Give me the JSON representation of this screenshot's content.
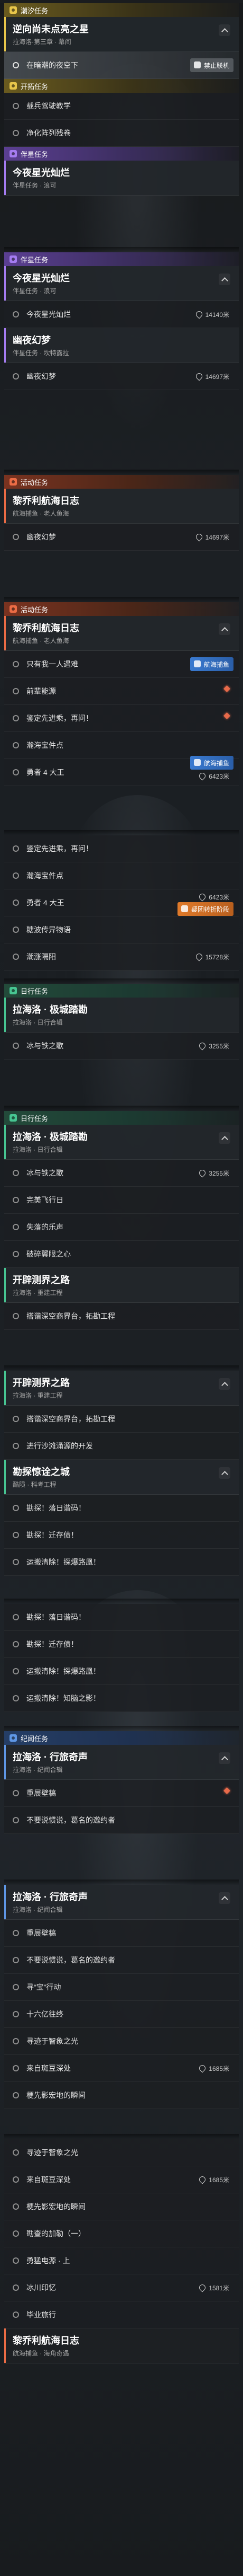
{
  "colors": {
    "trial": "#e8c64a",
    "quest": "#a57cf2",
    "event": "#ec6c45",
    "daily": "#47c592",
    "story": "#5f97e6"
  },
  "cat": {
    "trial": "潮汐任务",
    "trailblaze": "开拓任务",
    "companion": "伴星任务",
    "event": "活动任务",
    "daily": "日常任务",
    "story": "纪闻任务"
  },
  "s1": {
    "h1": "潮汐任务",
    "title": "逆向尚未点亮之星",
    "sub": "拉海洛·第三章 · 幕间",
    "item1": "在暗潮的夜空下",
    "tag": "禁止联机",
    "h2": "开拓任务",
    "i2": "载兵驾驶教学",
    "i3": "净化阵列残卷"
  },
  "s2": {
    "h": "伴星任务",
    "title": "今夜星光灿烂",
    "sub": "伴星任务 · 浪可"
  },
  "s3": {
    "h": "伴星任务",
    "title": "今夜星光灿烂",
    "sub": "伴星任务 · 浪可",
    "i1": "今夜星光灿烂",
    "d1": "14140米",
    "title2": "幽夜幻梦",
    "sub2": "伴星任务 · 坎特露拉",
    "i2": "幽夜幻梦",
    "d2": "14697米"
  },
  "s4": {
    "h": "活动任务",
    "title": "黎乔利航海日志",
    "sub": "航海捕鱼 · 老人鱼海",
    "i1": "幽夜幻梦",
    "d1": "14697米"
  },
  "s5": {
    "h": "活动任务",
    "title": "黎乔利航海日志",
    "sub": "航海捕鱼 · 老人鱼海",
    "i1": "只有我一人遇难",
    "tag1": "航海捕鱼",
    "i2": "前辈能源",
    "i3": "鉴定先进乘，再问！",
    "i4": "瀚海宝件点",
    "i5": "勇者 4 大王",
    "tag2": "航海捕鱼",
    "d5": "6423米"
  },
  "s6": {
    "i1": "鉴定先进乘，再问！",
    "i2": "瀚海宝件点",
    "i3": "勇者 4 大王",
    "d3": "6423米",
    "tag": "疑团转折阶段",
    "i4": "糖波传异物语",
    "i5": "潮涨隔阳",
    "d5": "15728米"
  },
  "s7": {
    "h": "日行任务",
    "title": "拉海洛 · 极城踏勘",
    "sub": "拉海洛 · 日行合辑",
    "i1": "冰与铁之歌",
    "d1": "3255米"
  },
  "s8": {
    "h": "日行任务",
    "title": "拉海洛 · 极城踏勘",
    "sub": "拉海洛 · 日行合辑",
    "i1": "冰与铁之歌",
    "d1": "3255米",
    "i2": "完美飞行日",
    "i3": "失落的乐声",
    "i4": "破碎翼眼之心",
    "title2": "开辟测界之路",
    "sub2": "拉海洛 · 重建工程",
    "i5": "搭谐深空商界台，拓勘工程"
  },
  "s9": {
    "title": "开辟测界之路",
    "sub": "拉海洛 · 重建工程",
    "i1": "搭谐深空商界台，拓勘工程",
    "i2": "进行沙滩涌源的开发",
    "title2": "勘探惊诠之城",
    "sub2": "酷陨 · 科考工程",
    "i3": "勘探！落日谐码！",
    "i4": "勘探！迁存债！",
    "i5": "运搬清除！探爆路凰！"
  },
  "s10": {
    "i1": "勘探！落日谐码！",
    "i2": "勘探！迁存债！",
    "i3": "运搬清除！探爆路凰！",
    "i4": "运搬清除！知脑之影！"
  },
  "s11": {
    "h": "纪闻任务",
    "title": "拉海洛 · 行旅奇声",
    "sub": "拉海洛 · 纪闻合辑",
    "i1": "重展壁稿",
    "i2": "不要说惯说，葛名的邀约者"
  },
  "s12": {
    "title": "拉海洛 · 行旅奇声",
    "sub": "拉海洛 · 纪闻合辑",
    "i1": "重展壁稿",
    "i2": "不要说惯说，葛名的邀约者",
    "i3": "寻“宝”行动",
    "i4": "十六亿往终",
    "i5": "寻迹于智象之光",
    "i6": "来自斑豆深处",
    "d6": "1685米",
    "i7": "梗先影宏地的瞬间"
  },
  "s13": {
    "i1": "寻迹于智象之光",
    "i2": "来自斑豆深处",
    "d2": "1685米",
    "i3": "梗先影宏地的瞬间",
    "i4": "勘查的加勒（一）",
    "i5": "勇猛电源 · 上",
    "i6": "冰川印忆",
    "d6": "1581米",
    "i7": "毕业旅行",
    "title": "黎乔利航海日志",
    "sub": "航海捕鱼 · 海角奇遇"
  }
}
